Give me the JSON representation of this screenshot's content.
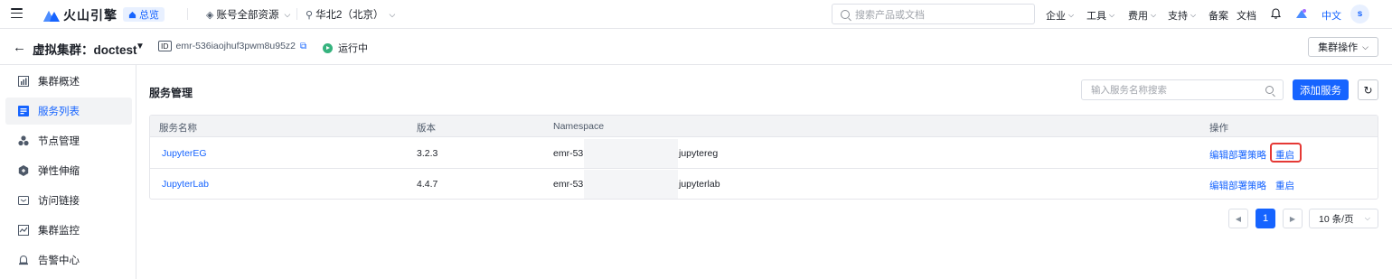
{
  "topnav": {
    "brand": "火山引擎",
    "home_pill": "总览",
    "resource_scope": "账号全部资源",
    "region": "华北2（北京）",
    "search_placeholder": "搜索产品或文档",
    "links": [
      "企业",
      "工具",
      "费用",
      "支持",
      "备案",
      "文档"
    ],
    "language": "中文",
    "avatar_initial": "s"
  },
  "cluster": {
    "title": "虚拟集群：doctest",
    "id_label": "ID",
    "id_value": "emr-536iaojhuf3pwm8u95z2",
    "status": "运行中",
    "ops_button": "集群操作"
  },
  "sidebar": {
    "items": [
      {
        "label": "集群概述",
        "icon": "chart-icon"
      },
      {
        "label": "服务列表",
        "icon": "list-icon",
        "active": true
      },
      {
        "label": "节点管理",
        "icon": "nodes-icon"
      },
      {
        "label": "弹性伸缩",
        "icon": "scale-icon"
      },
      {
        "label": "访问链接",
        "icon": "link-icon"
      },
      {
        "label": "集群监控",
        "icon": "monitor-icon"
      },
      {
        "label": "告警中心",
        "icon": "alarm-icon"
      }
    ]
  },
  "main": {
    "title": "服务管理",
    "search_placeholder": "输入服务名称搜索",
    "add_button": "添加服务",
    "table": {
      "headers": [
        "服务名称",
        "版本",
        "Namespace",
        "操作"
      ],
      "rows": [
        {
          "name": "JupyterEG",
          "version": "3.2.3",
          "ns_prefix": "emr-53",
          "ns_suffix": "jupytereg",
          "action_edit": "编辑部署策略",
          "action_restart": "重启"
        },
        {
          "name": "JupyterLab",
          "version": "4.4.7",
          "ns_prefix": "emr-53",
          "ns_suffix": "jupyterlab",
          "action_edit": "编辑部署策略",
          "action_restart": "重启"
        }
      ]
    },
    "pagination": {
      "current_page": "1",
      "page_size": "10 条/页"
    }
  },
  "colors": {
    "accent": "#1664ff",
    "highlight": "#e53935",
    "running": "#36b37e"
  }
}
